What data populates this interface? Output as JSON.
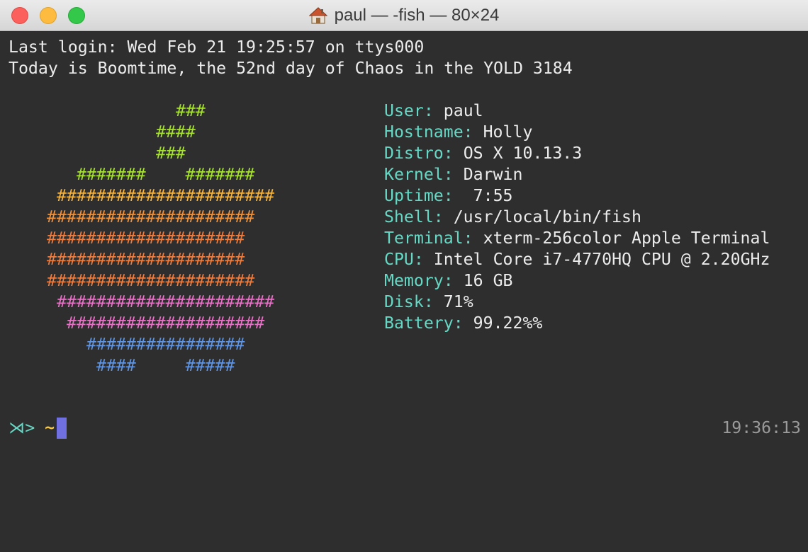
{
  "window": {
    "title": "paul — -fish — 80×24"
  },
  "terminal": {
    "login_line": "Last login: Wed Feb 21 19:25:57 on ttys000",
    "date_line": "Today is Boomtime, the 52nd day of Chaos in the YOLD 3184",
    "logo": [
      {
        "text": "###",
        "color": "#a6e22e"
      },
      {
        "text": "####",
        "color": "#a6e22e"
      },
      {
        "text": "###",
        "color": "#a6e22e"
      },
      {
        "text": "#######    #######",
        "color": "#a6e22e"
      },
      {
        "text": "######################",
        "color": "#f6b43f"
      },
      {
        "text": "#####################",
        "color": "#f0923c"
      },
      {
        "text": "####################",
        "color": "#ee7d3f"
      },
      {
        "text": "####################",
        "color": "#ee7d3f"
      },
      {
        "text": "#####################",
        "color": "#ee7d3f"
      },
      {
        "text": "######################",
        "color": "#e872c7"
      },
      {
        "text": "####################",
        "color": "#e872c7"
      },
      {
        "text": "################",
        "color": "#5f95e3"
      },
      {
        "text": "####     #####",
        "color": "#5f95e3"
      }
    ],
    "info": [
      {
        "label": "User:",
        "value": " paul"
      },
      {
        "label": "Hostname:",
        "value": " Holly"
      },
      {
        "label": "Distro:",
        "value": " OS X 10.13.3"
      },
      {
        "label": "Kernel:",
        "value": " Darwin"
      },
      {
        "label": "Uptime:",
        "value": "  7:55"
      },
      {
        "label": "Shell:",
        "value": " /usr/local/bin/fish"
      },
      {
        "label": "Terminal:",
        "value": " xterm-256color Apple Terminal"
      },
      {
        "label": "CPU:",
        "value": " Intel Core i7-4770HQ CPU @ 2.20GHz"
      },
      {
        "label": "Memory:",
        "value": " 16 GB"
      },
      {
        "label": "Disk:",
        "value": " 71%"
      },
      {
        "label": "Battery:",
        "value": " 99.22%%"
      }
    ],
    "prompt": {
      "fish": "⋊>",
      "cwd": "~",
      "time": "19:36:13"
    }
  },
  "colors": {
    "background": "#2e2e2e",
    "label": "#65d9c5",
    "cursor": "#7070e0"
  }
}
